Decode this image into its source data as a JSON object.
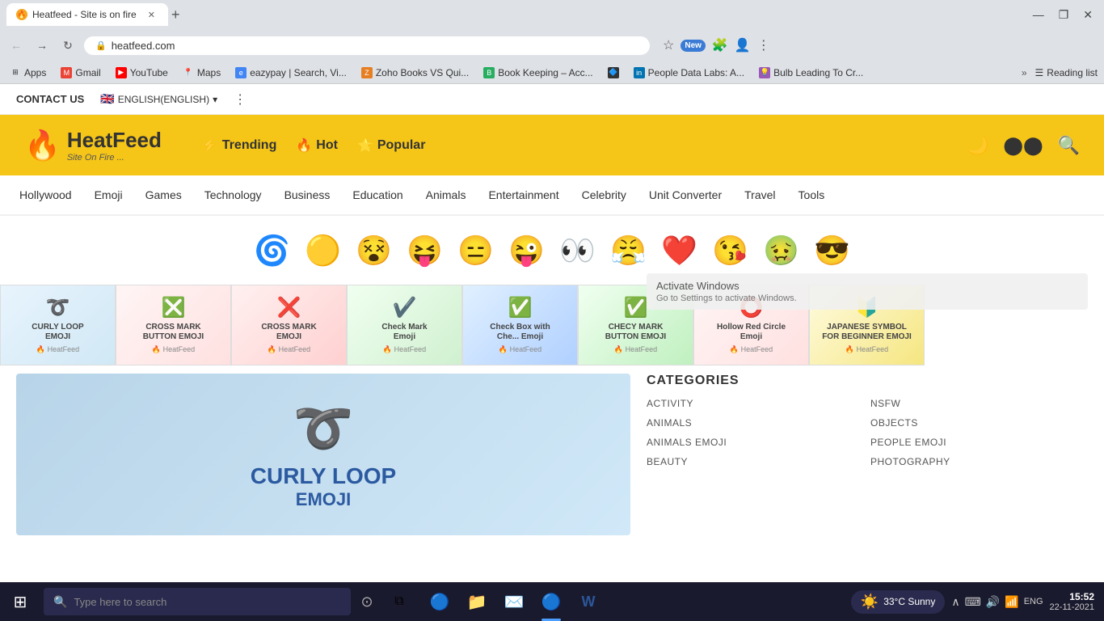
{
  "browser": {
    "tab_title": "Heatfeed - Site is on fire",
    "tab_favicon": "🔥",
    "url": "heatfeed.com",
    "new_tab_tooltip": "New tab",
    "minimize": "—",
    "restore": "❐",
    "close": "✕",
    "bookmarks": [
      {
        "label": "Apps",
        "icon": "⊞"
      },
      {
        "label": "Gmail",
        "icon": "M"
      },
      {
        "label": "YouTube",
        "icon": "▶"
      },
      {
        "label": "Maps",
        "icon": "📍"
      },
      {
        "label": "eazypay | Search, Vi...",
        "icon": "💳"
      },
      {
        "label": "Zoho Books VS Qui...",
        "icon": "📋"
      },
      {
        "label": "Book Keeping – Acc...",
        "icon": "📊"
      },
      {
        "label": "",
        "icon": "🔷"
      },
      {
        "label": "People Data Labs: A...",
        "icon": "💼"
      },
      {
        "label": "Bulb Leading To Cr...",
        "icon": "💡"
      }
    ],
    "bookmarks_more": "»",
    "reading_list": "Reading list"
  },
  "topbar": {
    "contact_us": "CONTACT US",
    "language": "ENGLISH(ENGLISH)",
    "flag": "🇬🇧"
  },
  "header": {
    "logo_name": "HeatFeed",
    "logo_sub": "Site On Fire ...",
    "nav_items": [
      {
        "icon": "⚡",
        "label": "Trending"
      },
      {
        "icon": "🔥",
        "label": "Hot"
      },
      {
        "icon": "⭐",
        "label": "Popular"
      }
    ]
  },
  "main_nav": {
    "items": [
      "Hollywood",
      "Emoji",
      "Games",
      "Technology",
      "Business",
      "Education",
      "Animals",
      "Entertainment",
      "Celebrity",
      "Unit Converter",
      "Travel",
      "Tools"
    ]
  },
  "emojis": [
    "🌀",
    "🟡",
    "😵",
    "😝",
    "😑",
    "😜",
    "👀",
    "😤",
    "❤️",
    "😘",
    "🤢",
    "😎"
  ],
  "image_cards": [
    {
      "label": "CURLY LOOP EMOJI",
      "symbol": "➰",
      "bg": "card-1"
    },
    {
      "label": "CROSS MARK BUTTON EMOJI",
      "symbol": "❎",
      "bg": "card-2"
    },
    {
      "label": "CROSS MARK EMOJI",
      "symbol": "❌",
      "bg": "card-3"
    },
    {
      "label": "Check Mark Emoji",
      "symbol": "✔️",
      "bg": "card-4"
    },
    {
      "label": "Check Box with Che... Emoji",
      "symbol": "✅",
      "bg": "card-5"
    },
    {
      "label": "CHECY MARK BUTTON EMOJI",
      "symbol": "✅",
      "bg": "card-6"
    },
    {
      "label": "Hollow Red Circle Emoji",
      "symbol": "⭕",
      "bg": "card-7"
    },
    {
      "label": "JAPANESE SYMBOL FOR BEGINNER EMOJI",
      "symbol": "🔰",
      "bg": "card-8"
    }
  ],
  "article": {
    "symbol": "➰",
    "title": "CURLY LOOP",
    "subtitle": "EMOJI"
  },
  "categories": {
    "title": "CATEGORIES",
    "items_left": [
      "ACTIVITY",
      "ANIMALS",
      "ANIMALS EMOJI",
      "BEAUTY"
    ],
    "items_right": [
      "NSFW",
      "OBJECTS",
      "PEOPLE EMOJI",
      "PHOTOGRAPHY"
    ]
  },
  "taskbar": {
    "search_placeholder": "Type here to search",
    "weather": "33°C Sunny",
    "time": "15:52",
    "date": "22-11-2021",
    "language": "ENG",
    "apps": [
      {
        "icon": "⊞",
        "label": "start"
      },
      {
        "icon": "🔵",
        "label": "chrome",
        "active": true
      },
      {
        "icon": "📁",
        "label": "explorer"
      },
      {
        "icon": "✉️",
        "label": "mail"
      },
      {
        "icon": "🔵",
        "label": "chrome2"
      },
      {
        "icon": "W",
        "label": "word"
      }
    ]
  },
  "activate_windows": {
    "line1": "Activate Windows",
    "line2": "Go to Settings to activate Windows."
  }
}
